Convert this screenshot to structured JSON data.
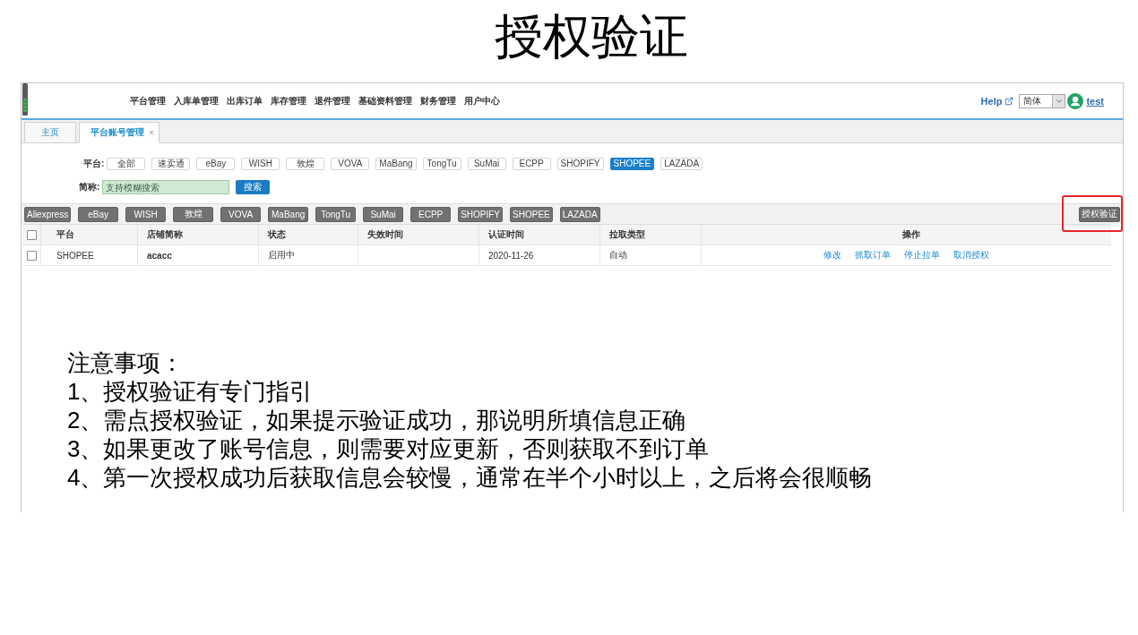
{
  "title": "授权验证",
  "header": {
    "nav": [
      "平台管理",
      "入库单管理",
      "出库订单",
      "库存管理",
      "退件管理",
      "基础资料管理",
      "财务管理",
      "用户中心"
    ],
    "help": "Help",
    "language": "简体",
    "user": "test"
  },
  "tabs": [
    {
      "label": "主页",
      "selected": false,
      "closable": false
    },
    {
      "label": "平台账号管理",
      "selected": true,
      "closable": true
    }
  ],
  "filters": {
    "platform_label": "平台:",
    "platforms": [
      {
        "label": "全部",
        "selected": false
      },
      {
        "label": "速卖通",
        "selected": false
      },
      {
        "label": "eBay",
        "selected": false
      },
      {
        "label": "WISH",
        "selected": false
      },
      {
        "label": "敦煌",
        "selected": false
      },
      {
        "label": "VOVA",
        "selected": false
      },
      {
        "label": "MaBang",
        "selected": false
      },
      {
        "label": "TongTu",
        "selected": false
      },
      {
        "label": "SuMai",
        "selected": false
      },
      {
        "label": "ECPP",
        "selected": false
      },
      {
        "label": "SHOPIFY",
        "selected": false
      },
      {
        "label": "SHOPEE",
        "selected": true
      },
      {
        "label": "LAZADA",
        "selected": false
      }
    ],
    "name_label": "简称:",
    "name_field": {
      "placeholder": "支持模糊搜索"
    },
    "search_button": "搜索"
  },
  "toolbar": {
    "platform_buttons": [
      "Aliexpress",
      "eBay",
      "WISH",
      "敦煌",
      "VOVA",
      "MaBang",
      "TongTu",
      "SuMai",
      "ECPP",
      "SHOPIFY",
      "SHOPEE",
      "LAZADA"
    ],
    "verify_button": {
      "label": "授权验证",
      "highlighted": true
    }
  },
  "table": {
    "columns": [
      "平台",
      "店铺简称",
      "状态",
      "失效时间",
      "认证时间",
      "拉取类型",
      "操作"
    ],
    "header_checked": false,
    "rows": [
      {
        "checked": false,
        "platform": "SHOPEE",
        "shop": "acacc",
        "status": "启用中",
        "verified_at": "2020-11-26",
        "pull_type": "自动",
        "actions": [
          "修改",
          "抓取订单",
          "停止拉单",
          "取消授权"
        ]
      }
    ]
  },
  "notes": {
    "title": "注意事项：",
    "items": [
      "1、授权验证有专门指引",
      "2、需点授权验证，如果提示验证成功，那说明所填信息正确",
      "3、如果更改了账号信息，则需要对应更新，否则获取不到订单",
      "4、第一次授权成功后获取信息会较慢，通常在半个小时以上，之后将会很顺畅"
    ]
  }
}
